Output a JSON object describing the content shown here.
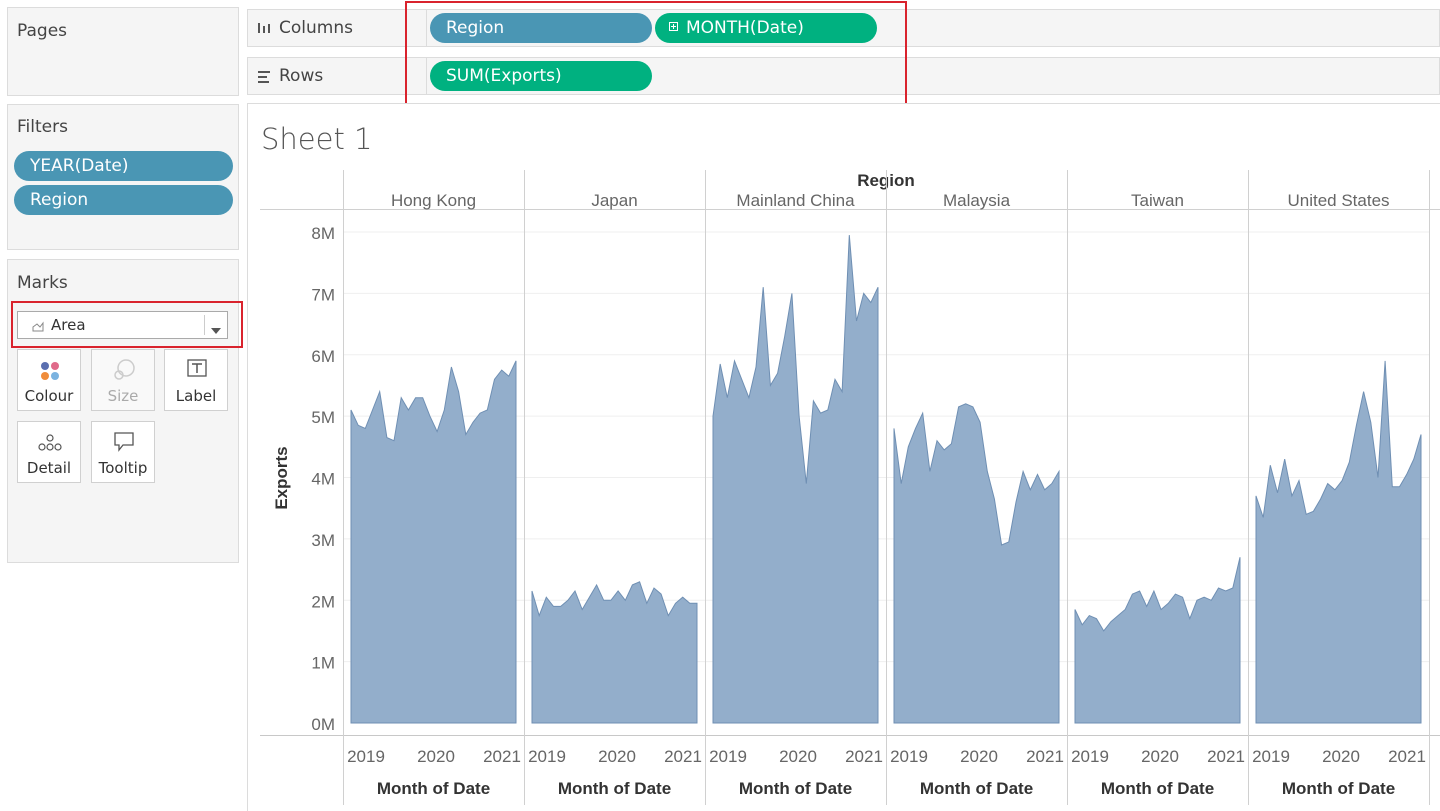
{
  "pages": {
    "title": "Pages"
  },
  "filters": {
    "title": "Filters",
    "items": [
      "YEAR(Date)",
      "Region"
    ]
  },
  "marks": {
    "title": "Marks",
    "type": "Area",
    "buttons": {
      "colour": "Colour",
      "size": "Size",
      "label": "Label",
      "detail": "Detail",
      "tooltip": "Tooltip"
    }
  },
  "shelves": {
    "columns": {
      "label": "Columns",
      "pills": [
        "Region",
        "MONTH(Date)"
      ]
    },
    "rows": {
      "label": "Rows",
      "pills": [
        "SUM(Exports)"
      ]
    }
  },
  "sheet": {
    "title": "Sheet 1"
  },
  "colors": {
    "area_fill": "#93aecb",
    "area_stroke": "#6f8fb3",
    "dimension_pill": "#4a96b4",
    "measure_pill": "#00b180",
    "highlight": "#d9232d"
  },
  "chart_data": {
    "type": "area",
    "column_header": "Region",
    "panels": [
      "Hong Kong",
      "Japan",
      "Mainland China",
      "Malaysia",
      "Taiwan",
      "United States"
    ],
    "ylabel": "Exports",
    "xlabel": "Month of Date",
    "x_ticks": [
      "2019",
      "2020",
      "2021"
    ],
    "y_ticks": [
      "0M",
      "1M",
      "2M",
      "3M",
      "4M",
      "5M",
      "6M",
      "7M",
      "8M"
    ],
    "ylim": [
      0,
      8.4
    ],
    "unit": "M",
    "x_start": "2019-01",
    "x_end": "2021-06",
    "series": [
      {
        "region": "Hong Kong",
        "values": [
          5.1,
          4.85,
          4.8,
          5.1,
          5.4,
          4.65,
          4.6,
          5.3,
          5.1,
          5.3,
          5.3,
          5.0,
          4.75,
          5.1,
          5.8,
          5.4,
          4.7,
          4.9,
          5.05,
          5.1,
          5.6,
          5.75,
          5.65,
          5.9
        ]
      },
      {
        "region": "Japan",
        "values": [
          2.15,
          1.75,
          2.05,
          1.9,
          1.9,
          2.0,
          2.15,
          1.85,
          2.05,
          2.25,
          2.0,
          2.0,
          2.15,
          2.0,
          2.25,
          2.3,
          1.95,
          2.2,
          2.1,
          1.75,
          1.95,
          2.05,
          1.95,
          1.95
        ]
      },
      {
        "region": "Mainland China",
        "values": [
          5.0,
          5.85,
          5.3,
          5.9,
          5.6,
          5.3,
          5.8,
          7.1,
          5.5,
          5.7,
          6.3,
          7.0,
          5.0,
          3.9,
          5.25,
          5.05,
          5.1,
          5.6,
          5.4,
          7.95,
          6.55,
          7.0,
          6.85,
          7.1
        ]
      },
      {
        "region": "Malaysia",
        "values": [
          4.8,
          3.9,
          4.5,
          4.8,
          5.05,
          4.1,
          4.6,
          4.45,
          4.55,
          5.15,
          5.2,
          5.15,
          4.9,
          4.1,
          3.65,
          2.9,
          2.95,
          3.6,
          4.1,
          3.8,
          4.05,
          3.8,
          3.9,
          4.1
        ]
      },
      {
        "region": "Taiwan",
        "values": [
          1.85,
          1.6,
          1.75,
          1.7,
          1.5,
          1.65,
          1.75,
          1.85,
          2.1,
          2.15,
          1.9,
          2.15,
          1.85,
          1.95,
          2.1,
          2.05,
          1.7,
          2.0,
          2.05,
          2.0,
          2.2,
          2.15,
          2.2,
          2.7
        ]
      },
      {
        "region": "United States",
        "values": [
          3.7,
          3.35,
          4.2,
          3.75,
          4.3,
          3.7,
          3.95,
          3.4,
          3.45,
          3.65,
          3.9,
          3.8,
          3.95,
          4.25,
          4.85,
          5.4,
          4.9,
          4.0,
          5.9,
          3.85,
          3.85,
          4.05,
          4.3,
          4.7
        ]
      }
    ]
  }
}
